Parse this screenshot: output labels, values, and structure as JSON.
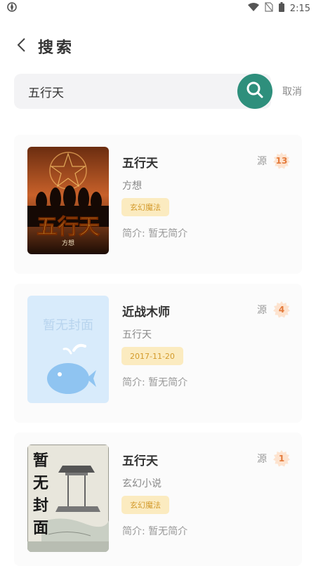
{
  "status_bar": {
    "time": "2:15"
  },
  "header": {
    "title": "搜索"
  },
  "search": {
    "value": "五行天",
    "cancel_label": "取消"
  },
  "colors": {
    "accent": "#2e8f7c",
    "tag_bg": "#fbebc0",
    "tag_text": "#d39a2b",
    "badge": "#e37a3b"
  },
  "results": [
    {
      "title": "五行天",
      "author": "方想",
      "tag": "玄幻魔法",
      "intro": "简介: 暂无简介",
      "source_label": "源",
      "source_count": "13",
      "cover": {
        "type": "image",
        "title_text": "五行天",
        "author_text": "方想"
      }
    },
    {
      "title": "近战木师",
      "author": "五行天",
      "tag": "2017-11-20",
      "intro": "简介: 暂无简介",
      "source_label": "源",
      "source_count": "4",
      "cover": {
        "type": "placeholder",
        "text": "暂无封面"
      }
    },
    {
      "title": "五行天",
      "author": "玄幻小说",
      "tag": "玄幻魔法",
      "intro": "简介: 暂无简介",
      "source_label": "源",
      "source_count": "1",
      "cover": {
        "type": "painting",
        "text": "暂无封面"
      }
    }
  ]
}
